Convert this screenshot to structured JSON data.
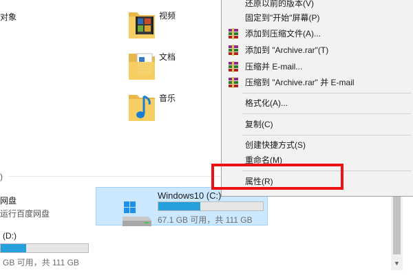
{
  "left_labels": {
    "objects_tail": "对象",
    "section_tail": ")",
    "netdisk_name_tail": "网盘",
    "netdisk_desc_tail": "运行百度网盘",
    "drive_d_tail": "(D:)",
    "drive_d_info_tail": "GB 可用，共 111 GB"
  },
  "folders": [
    {
      "label": "视频",
      "icon": "video-folder-icon"
    },
    {
      "label": "文档",
      "icon": "documents-folder-icon"
    },
    {
      "label": "音乐",
      "icon": "music-folder-icon"
    }
  ],
  "drives": {
    "c": {
      "name": "Windows10 (C:)",
      "info": "67.1 GB 可用，共 111 GB",
      "used_fraction": 0.4
    },
    "d": {
      "used_fraction": 0.29
    }
  },
  "context_menu": {
    "items": [
      {
        "label": "还原以前的版本(V)",
        "icon": ""
      },
      {
        "label": "固定到\"开始\"屏幕(P)",
        "icon": ""
      },
      {
        "label": "添加到压缩文件(A)...",
        "icon": "winrar-icon"
      },
      {
        "label": "添加到 \"Archive.rar\"(T)",
        "icon": "winrar-icon"
      },
      {
        "label": "压缩并 E-mail...",
        "icon": "winrar-icon"
      },
      {
        "label": "压缩到 \"Archive.rar\" 并 E-mail",
        "icon": "winrar-icon"
      },
      {
        "label": "格式化(A)...",
        "icon": ""
      },
      {
        "label": "复制(C)",
        "icon": ""
      },
      {
        "label": "创建快捷方式(S)",
        "icon": ""
      },
      {
        "label": "重命名(M)",
        "icon": ""
      },
      {
        "label": "属性(R)",
        "icon": ""
      }
    ]
  },
  "colors": {
    "selection_bg": "#cce8ff",
    "drive_bar_fill": "#26a0da",
    "highlight_box": "#ee1111",
    "menu_bg": "#f2f2f2"
  }
}
